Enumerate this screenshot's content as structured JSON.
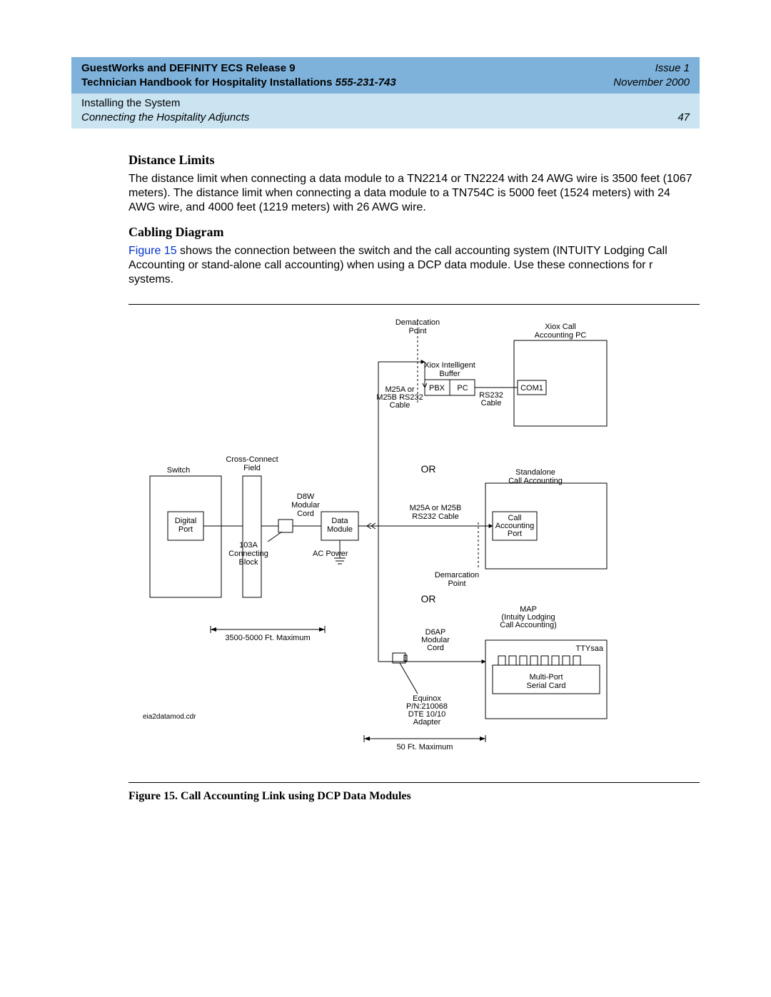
{
  "header": {
    "line1_left": "GuestWorks and DEFINITY ECS Release 9",
    "line1_right": "Issue 1",
    "line2_left_a": "Technician Handbook for Hospitality Installations  ",
    "line2_left_phone": "555-231-743",
    "line2_right": "November 2000",
    "crumb1": "Installing the System",
    "crumb2": "Connecting the Hospitality Adjuncts",
    "page_num": "47"
  },
  "sections": {
    "distance_title": "Distance Limits",
    "distance_body": "The distance limit when connecting a data module to a TN2214 or TN2224 with 24 AWG wire is 3500 feet (1067 meters). The distance limit when connecting a data module to a TN754C is 5000 feet (1524 meters) with 24 AWG wire, and 4000 feet (1219 meters) with 26 AWG wire.",
    "cabling_title": "Cabling Diagram",
    "cabling_body_pre": "",
    "cabling_figref": "Figure 15",
    "cabling_body_post": " shows the connection between the switch and the call accounting system (INTUITY Lodging Call Accounting or stand-alone call accounting) when using a DCP data module. Use these connections for r systems."
  },
  "diagram": {
    "switch": "Switch",
    "digital_port": "Digital\nPort",
    "ccf": "Cross-Connect\nField",
    "d8w": "D8W\nModular\nCord",
    "block_103a": "103A\nConnecting\nBlock",
    "ac_power": "AC Power",
    "data_module": "Data\nModule",
    "dist_3500": "3500-5000 Ft. Maximum",
    "eia_file": "eia2datamod.cdr",
    "demarc": "Demarcation\nPoint",
    "xib": "Xiox Intelligent\nBuffer",
    "pbx": "PBX",
    "pc": "PC",
    "m25a": "M25A or\nM25B RS232\nCable",
    "rs232": "RS232\nCable",
    "com1": "COM1",
    "xiox_pc": "Xiox Call\nAccounting PC",
    "or": "OR",
    "standalone": "Standalone\nCall Accounting",
    "m25a2": "M25A or M25B\nRS232 Cable",
    "ca_port": "Call\nAccounting\nPort",
    "demarc2": "Demarcation\nPoint",
    "map": "MAP\n(Intuity Lodging\nCall Accounting)",
    "d6ap": "D6AP\nModular\nCord",
    "ttysaa": "TTYsaa",
    "serial": "Multi-Port\nSerial Card",
    "equinox": "Equinox\nP/N:210068\nDTE 10/10\nAdapter",
    "fifty": "50 Ft. Maximum"
  },
  "figure_caption": "Figure 15.  Call Accounting Link using DCP Data Modules"
}
